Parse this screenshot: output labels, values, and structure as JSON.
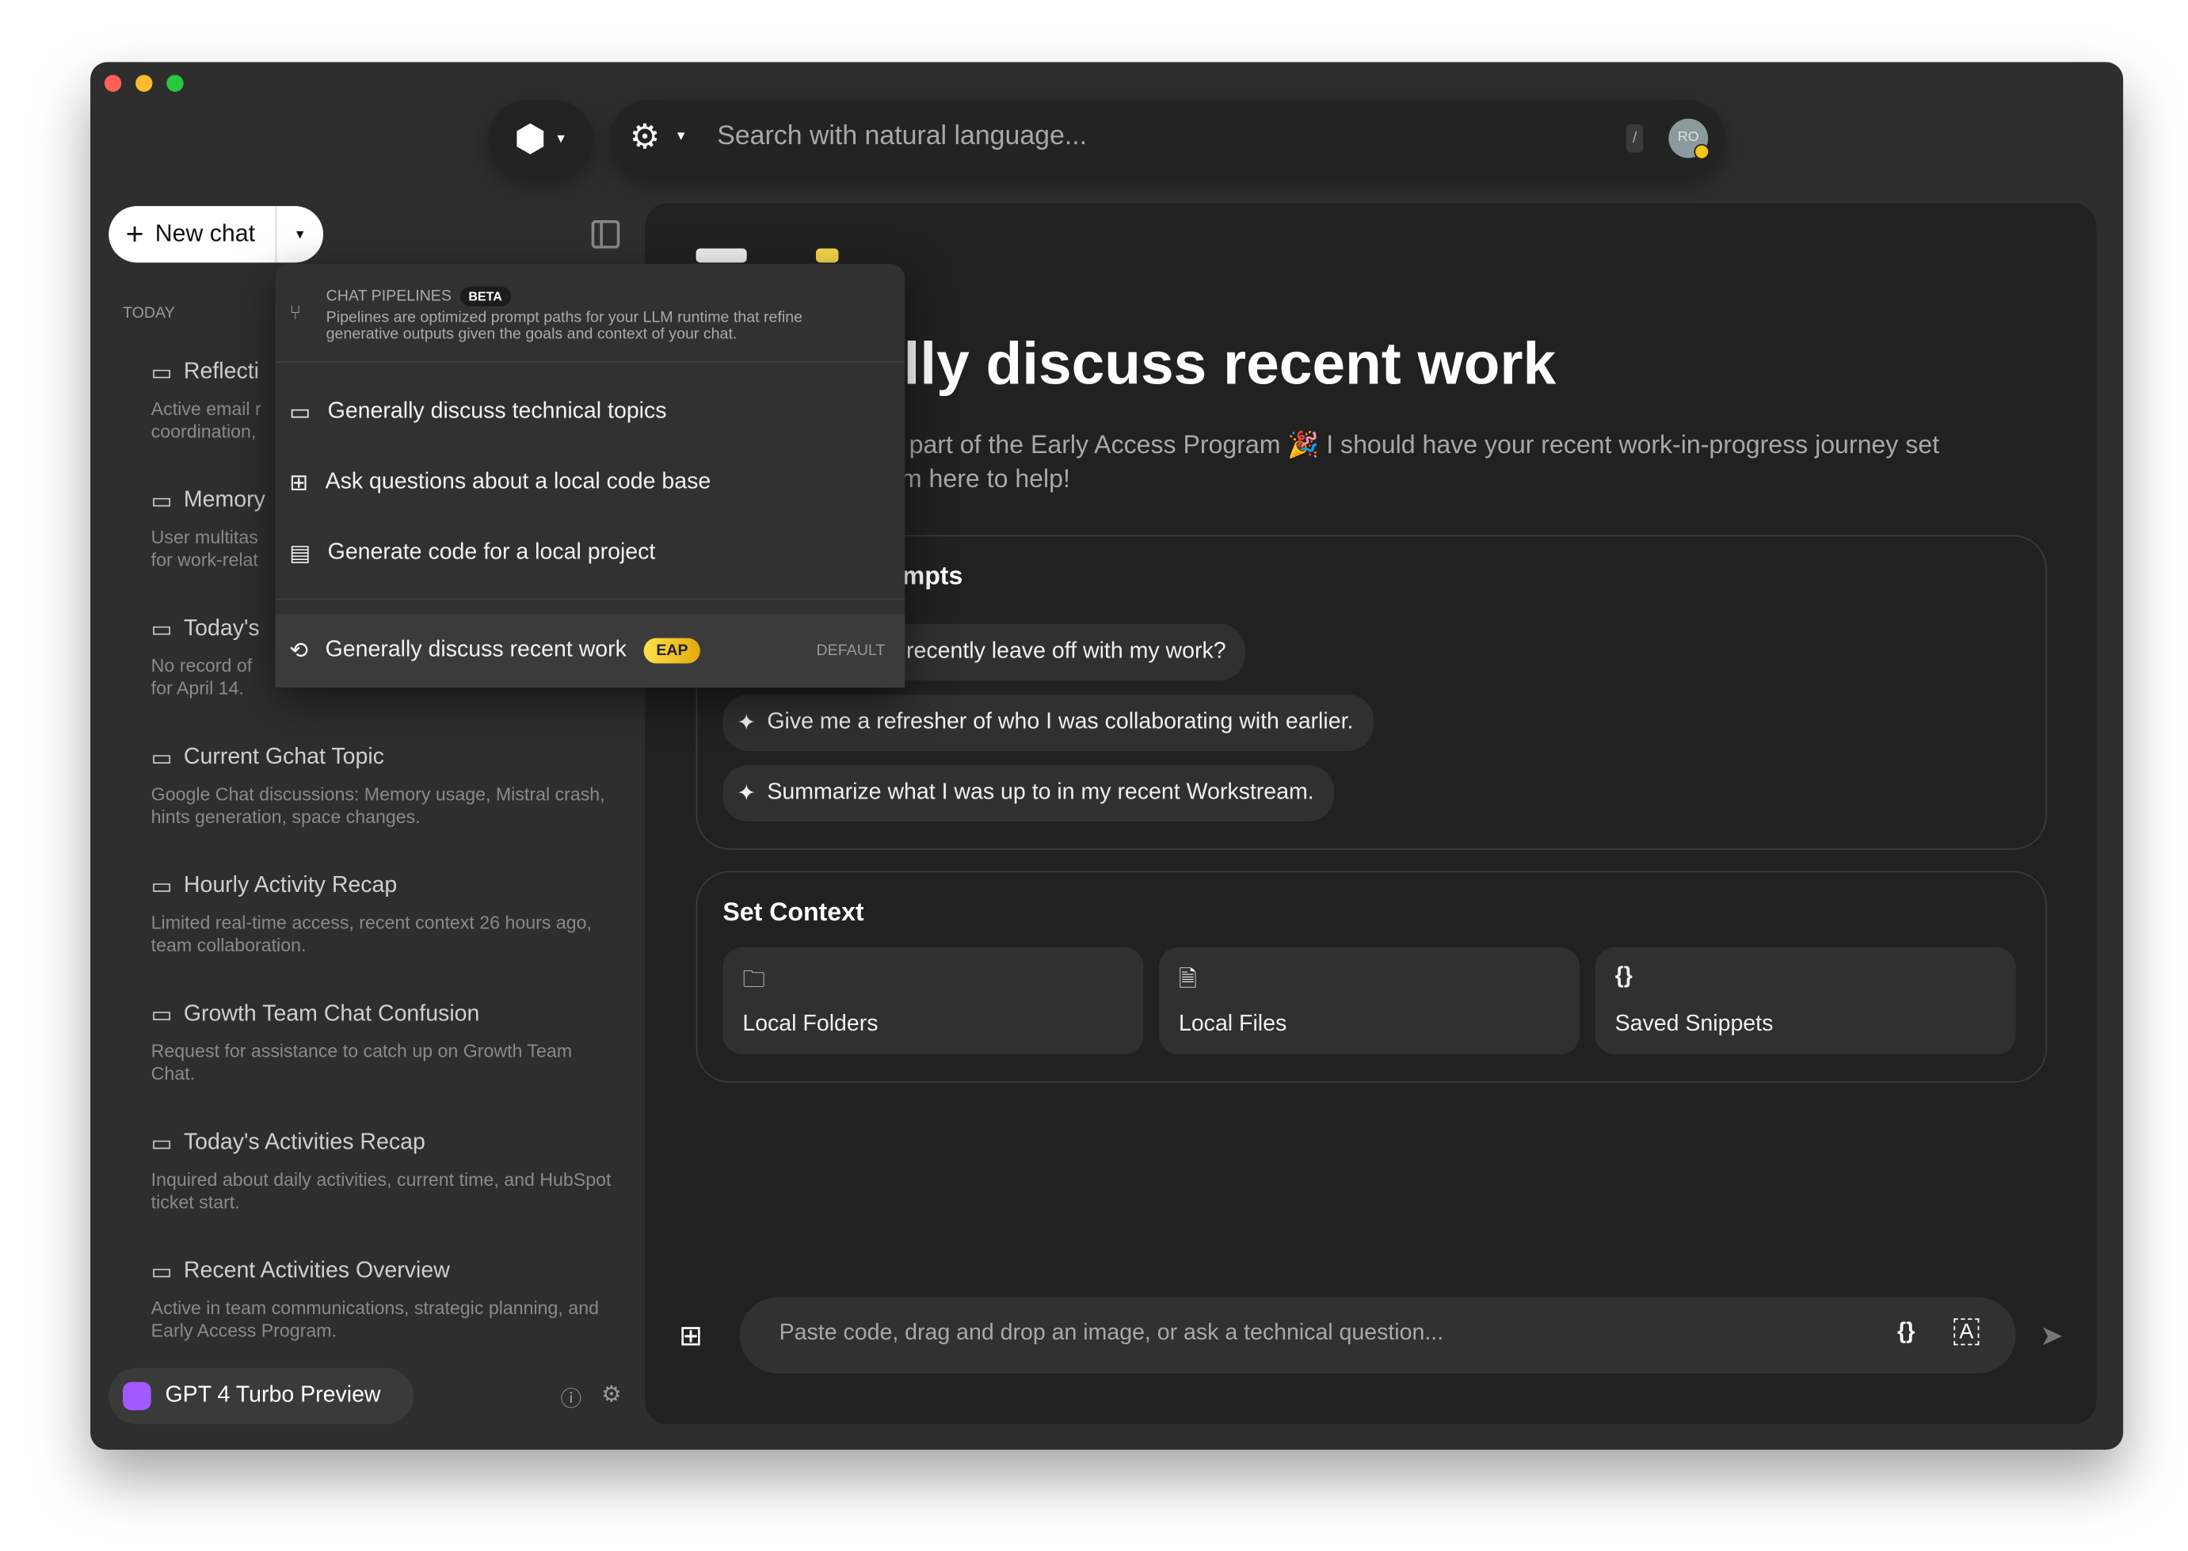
{
  "window": {
    "traffic_lights": [
      "#ff5f57",
      "#febc2e",
      "#28c840"
    ]
  },
  "topbar": {
    "search_placeholder": "Search with natural language...",
    "shortcut": "/",
    "avatar_initials": "RO"
  },
  "sidebar": {
    "new_chat": "New chat",
    "section": "TODAY",
    "items": [
      {
        "title": "Reflecti",
        "desc": "Active email r\ncoordination,"
      },
      {
        "title": "Memory",
        "desc": "User multitas\nfor work-relat"
      },
      {
        "title": "Today's",
        "desc": "No record of\nfor April 14."
      },
      {
        "title": "Current Gchat Topic",
        "desc": "Google Chat discussions: Memory usage, Mistral crash, hints generation, space changes."
      },
      {
        "title": "Hourly Activity Recap",
        "desc": "Limited real-time access, recent context 26 hours ago, team collaboration."
      },
      {
        "title": "Growth Team Chat Confusion",
        "desc": "Request for assistance to catch up on Growth Team Chat."
      },
      {
        "title": "Today's Activities Recap",
        "desc": "Inquired about daily activities, current time, and HubSpot ticket start."
      },
      {
        "title": "Recent Activities Overview",
        "desc": "Active in team communications, strategic planning, and Early Access Program."
      }
    ],
    "model": "GPT 4 Turbo Preview"
  },
  "menu": {
    "header": "CHAT PIPELINES",
    "beta": "BETA",
    "description": "Pipelines are optimized prompt paths for your LLM runtime that refine generative outputs given the goals and context of your chat.",
    "items": [
      "Generally discuss technical topics",
      "Ask questions about a local code base",
      "Generate code for a local project"
    ],
    "selected": {
      "label": "Generally discuss recent work",
      "badge": "EAP",
      "tag": "DEFAULT"
    }
  },
  "main": {
    "title": "lly discuss recent work",
    "subtitle_1": "part of the Early Access Program 🎉 I should have your recent work-in-progress journey set",
    "subtitle_2": "m here to help!",
    "prompts_title": "mpts",
    "prompts": [
      "recently leave off with my work?",
      "Give me a refresher of who I was collaborating with earlier.",
      "Summarize what I was up to in my recent Workstream."
    ],
    "context_title": "Set Context",
    "context": [
      "Local Folders",
      "Local Files",
      "Saved Snippets"
    ],
    "input_placeholder": "Paste code, drag and drop an image, or ask a technical question..."
  },
  "colors": {
    "accent_eap": "#f5c518",
    "model_icon": "#a259ff"
  }
}
